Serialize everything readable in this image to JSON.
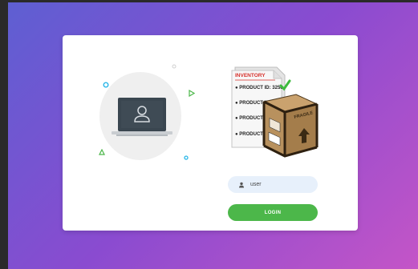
{
  "colors": {
    "gradient_start": "#5e5fd2",
    "gradient_end": "#c455c7",
    "card": "#ffffff",
    "login_button": "#4cb74a",
    "input_bg": "#e7f0fb"
  },
  "illustration": {
    "icon": "laptop-user-icon"
  },
  "inventory": {
    "heading": "INVENTORY",
    "items": [
      "PRODUCT ID: 3256",
      "PRODUCT ID: 3",
      "PRODUCT I",
      "PRODUCT I"
    ],
    "box_label": "FRAGILE",
    "icon": "shipping-box-icon"
  },
  "login": {
    "username_value": "user",
    "username_icon": "user-icon",
    "button_label": "LOGIN"
  }
}
